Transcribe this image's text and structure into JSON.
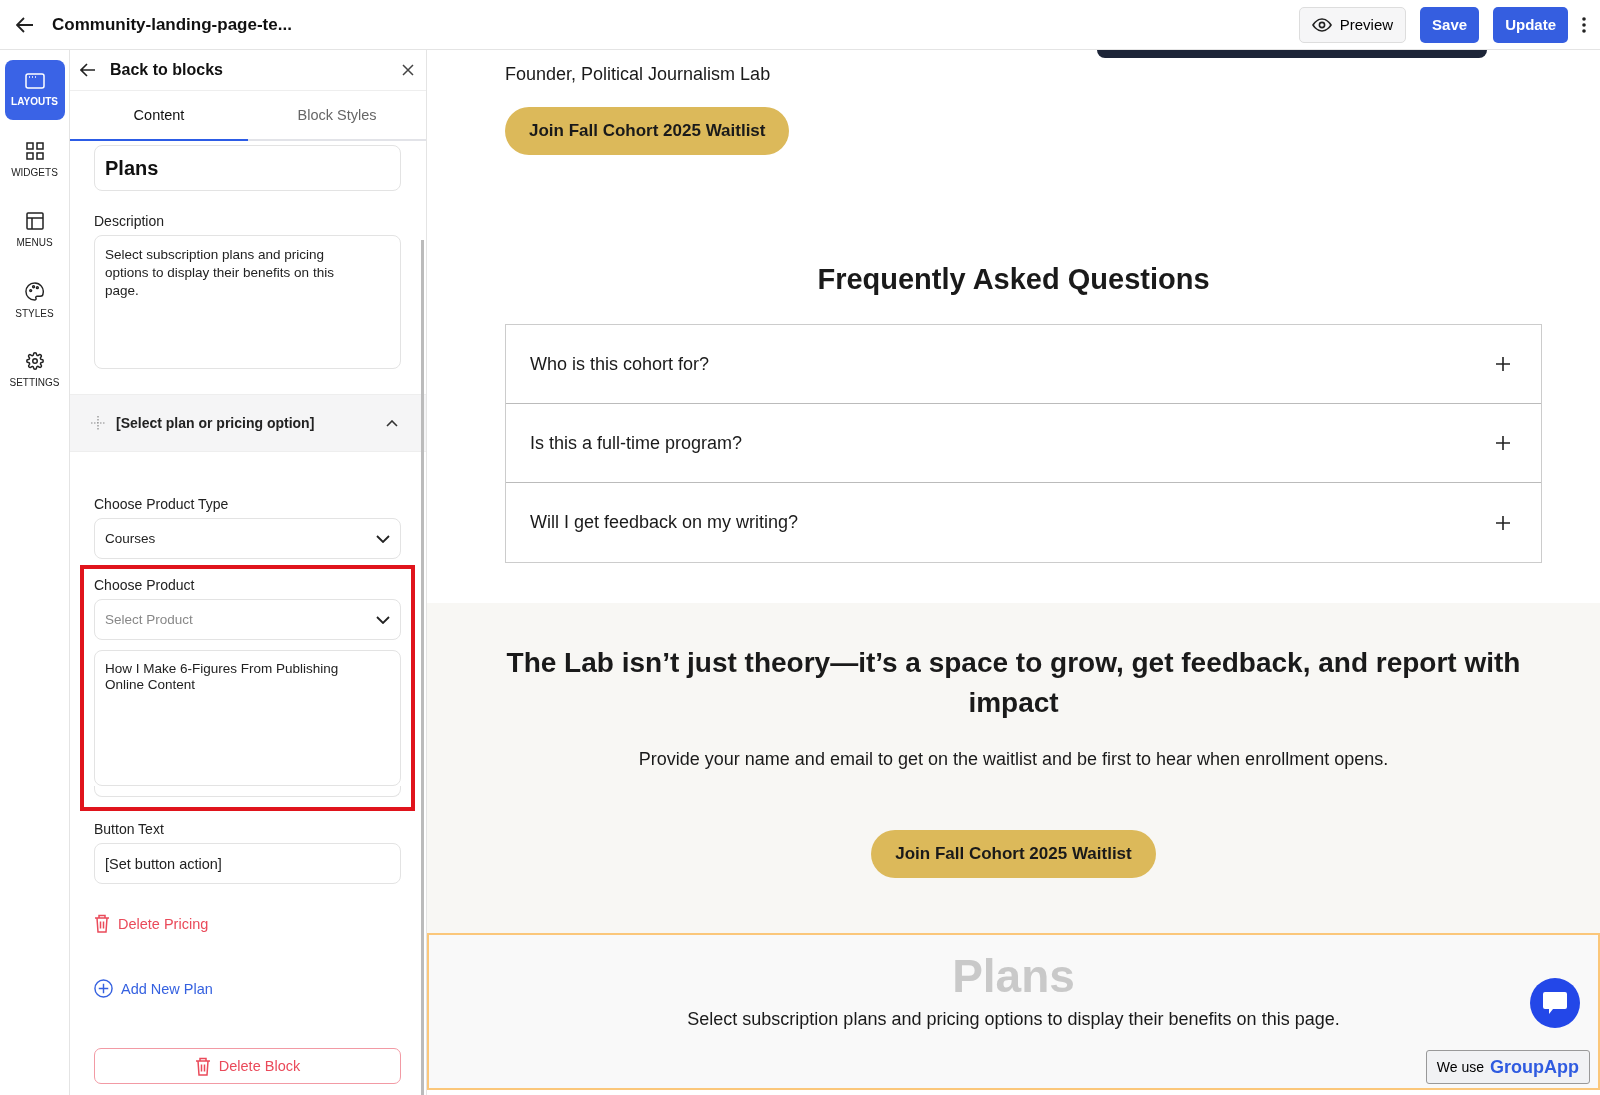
{
  "header": {
    "title": "Community-landing-page-te...",
    "buttons": [
      {
        "kind": "preview",
        "label": "Preview"
      },
      {
        "kind": "primary",
        "label": "Save"
      },
      {
        "kind": "primary",
        "label": "Update"
      }
    ]
  },
  "rail": [
    {
      "kind": "layouts",
      "label": "LAYOUTS",
      "selected": true
    },
    {
      "kind": "widgets",
      "label": "WIDGETS",
      "selected": false
    },
    {
      "kind": "menus",
      "label": "MENUS",
      "selected": false
    },
    {
      "kind": "styles",
      "label": "STYLES",
      "selected": false
    },
    {
      "kind": "settings",
      "label": "SETTINGS",
      "selected": false
    }
  ],
  "panel": {
    "back": "Back to blocks",
    "tabs": [
      {
        "label": "Content",
        "selected": true
      },
      {
        "label": "Block Styles",
        "selected": false
      }
    ],
    "title_value": "Plans",
    "description_label": "Description",
    "description_value": "Select subscription plans and pricing options to display their benefits on this page.",
    "section": {
      "label": "[Select plan or pricing option]",
      "expanded": true
    },
    "product_type_label": "Choose Product Type",
    "product_type_value": "Courses",
    "product_label": "Choose Product",
    "product_placeholder": "Select Product",
    "product_item": "How I Make 6-Figures From Publishing Online Content",
    "button_text_label": "Button Text",
    "button_text_value": "[Set button action]",
    "delete_pricing": "Delete Pricing",
    "add_plan": "Add New Plan",
    "delete_block": "Delete Block"
  },
  "preview": {
    "founder": "Founder, Political Journalism Lab",
    "cta_top": "Join Fall Cohort 2025 Waitlist",
    "faq_title": "Frequently Asked Questions",
    "faq": [
      {
        "question": "Who is this cohort for?",
        "expanded": false
      },
      {
        "question": "Is this a full-time program?",
        "expanded": false
      },
      {
        "question": "Will I get feedback on my writing?",
        "expanded": false
      }
    ],
    "headline": "The Lab isn’t just theory—it’s a space to grow, get feedback, and report with impact",
    "subtext": "Provide your name and email to get on the waitlist and be first to hear when enrollment opens.",
    "cta_bottom": "Join Fall Cohort 2025 Waitlist",
    "plans_title": "Plans",
    "plans_text": "Select subscription plans and pricing options to display their benefits on this page.",
    "badge_prefix": "We use",
    "badge_brand": "GroupApp"
  }
}
